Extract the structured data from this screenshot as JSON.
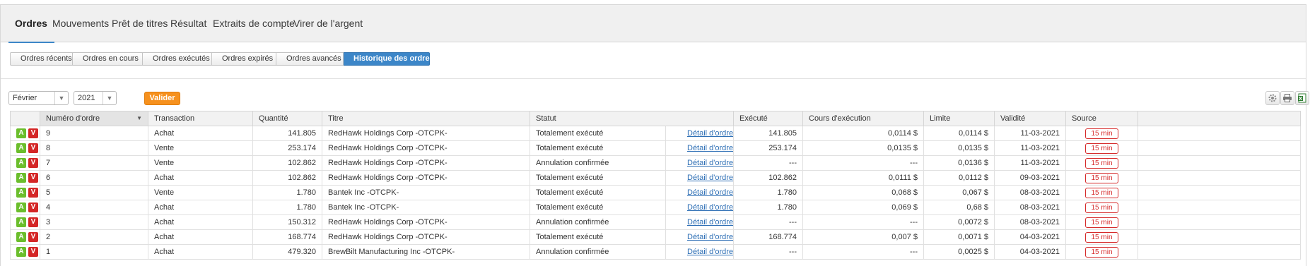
{
  "main_tabs": [
    "Ordres",
    "Mouvements",
    "Prêt de titres",
    "Résultat",
    "Extraits de compte",
    "Virer de l'argent"
  ],
  "sub_tabs": [
    "Ordres récents",
    "Ordres en cours",
    "Ordres exécutés",
    "Ordres expirés",
    "Ordres avancés",
    "Historique des ordres"
  ],
  "filter": {
    "month": "Février",
    "year": "2021",
    "submit_label": "Valider"
  },
  "toolbar_icons": [
    "settings-icon",
    "print-icon",
    "excel-export-icon"
  ],
  "table": {
    "headers": [
      "Numéro d'ordre",
      "Transaction",
      "Quantité",
      "Titre",
      "Statut",
      "Exécuté",
      "Cours d'exécution",
      "Limite",
      "Validité",
      "Source"
    ],
    "buy_badge": "A",
    "sell_badge": "V",
    "rows": [
      {
        "num": "9",
        "transaction": "Achat",
        "quantite": "141.805",
        "titre": "RedHawk Holdings Corp -OTCPK-",
        "statut": "Totalement exécuté",
        "detail": "Détail d'ordre",
        "execute": "141.805",
        "cours": "0,0114 $",
        "limite": "0,0114 $",
        "validite": "11-03-2021",
        "source": "15 min"
      },
      {
        "num": "8",
        "transaction": "Vente",
        "quantite": "253.174",
        "titre": "RedHawk Holdings Corp -OTCPK-",
        "statut": "Totalement exécuté",
        "detail": "Détail d'ordre",
        "execute": "253.174",
        "cours": "0,0135 $",
        "limite": "0,0135 $",
        "validite": "11-03-2021",
        "source": "15 min"
      },
      {
        "num": "7",
        "transaction": "Vente",
        "quantite": "102.862",
        "titre": "RedHawk Holdings Corp -OTCPK-",
        "statut": "Annulation confirmée",
        "detail": "Détail d'ordre",
        "execute": "---",
        "cours": "---",
        "limite": "0,0136 $",
        "validite": "11-03-2021",
        "source": "15 min"
      },
      {
        "num": "6",
        "transaction": "Achat",
        "quantite": "102.862",
        "titre": "RedHawk Holdings Corp -OTCPK-",
        "statut": "Totalement exécuté",
        "detail": "Détail d'ordre",
        "execute": "102.862",
        "cours": "0,0111 $",
        "limite": "0,0112 $",
        "validite": "09-03-2021",
        "source": "15 min"
      },
      {
        "num": "5",
        "transaction": "Vente",
        "quantite": "1.780",
        "titre": "Bantek Inc -OTCPK-",
        "statut": "Totalement exécuté",
        "detail": "Détail d'ordre",
        "execute": "1.780",
        "cours": "0,068 $",
        "limite": "0,067 $",
        "validite": "08-03-2021",
        "source": "15 min"
      },
      {
        "num": "4",
        "transaction": "Achat",
        "quantite": "1.780",
        "titre": "Bantek Inc -OTCPK-",
        "statut": "Totalement exécuté",
        "detail": "Détail d'ordre",
        "execute": "1.780",
        "cours": "0,069 $",
        "limite": "0,68 $",
        "validite": "08-03-2021",
        "source": "15 min"
      },
      {
        "num": "3",
        "transaction": "Achat",
        "quantite": "150.312",
        "titre": "RedHawk Holdings Corp -OTCPK-",
        "statut": "Annulation confirmée",
        "detail": "Détail d'ordre",
        "execute": "---",
        "cours": "---",
        "limite": "0,0072 $",
        "validite": "08-03-2021",
        "source": "15 min"
      },
      {
        "num": "2",
        "transaction": "Achat",
        "quantite": "168.774",
        "titre": "RedHawk Holdings Corp -OTCPK-",
        "statut": "Totalement exécuté",
        "detail": "Détail d'ordre",
        "execute": "168.774",
        "cours": "0,007 $",
        "limite": "0,0071 $",
        "validite": "04-03-2021",
        "source": "15 min"
      },
      {
        "num": "1",
        "transaction": "Achat",
        "quantite": "479.320",
        "titre": "BrewBilt Manufacturing Inc -OTCPK-",
        "statut": "Annulation confirmée",
        "detail": "Détail d'ordre",
        "execute": "---",
        "cours": "---",
        "limite": "0,0025 $",
        "validite": "04-03-2021",
        "source": "15 min"
      }
    ]
  },
  "colors": {
    "accent": "#3c86c8",
    "valider": "#f6911e",
    "buy": "#6bbe2c",
    "sell": "#d42626",
    "source_badge": "#d62b2b",
    "link": "#2e6fb5"
  }
}
